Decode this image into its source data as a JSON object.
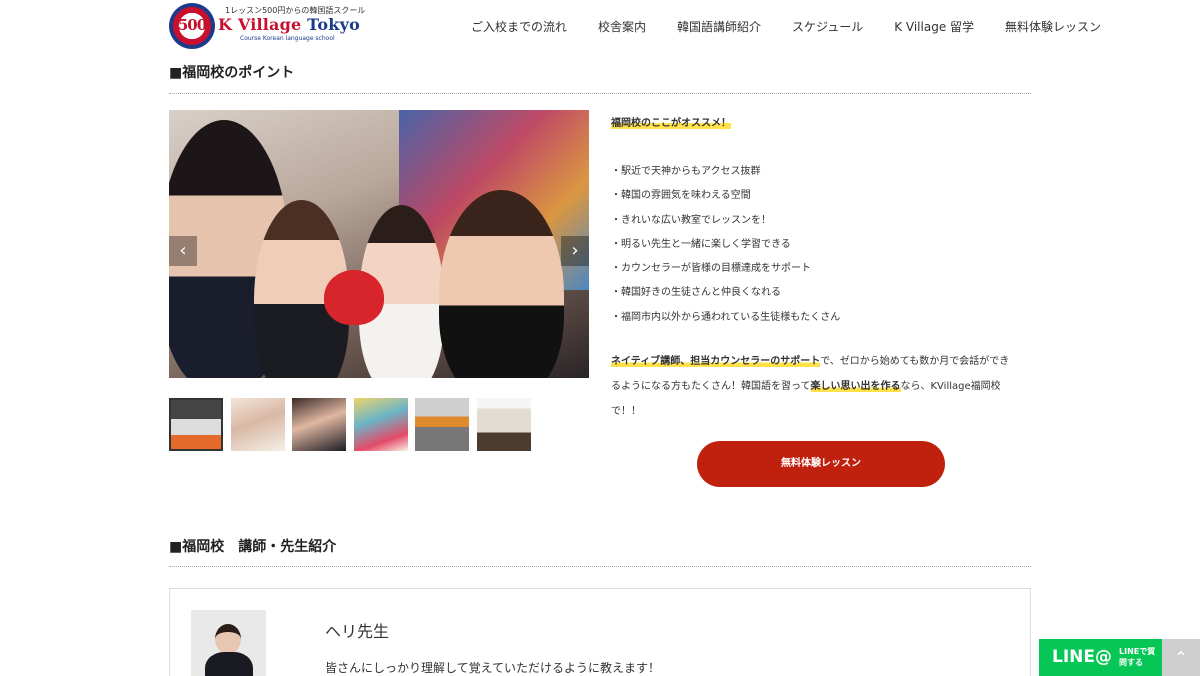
{
  "header": {
    "logo": {
      "badge_number": "500",
      "top_text": "1レッスン500円からの韓国語スクール",
      "main_text_a": "K Village ",
      "main_text_b": "Tokyo",
      "sub_text": "Course Korean language school"
    },
    "nav": [
      "ご入校までの流れ",
      "校舎案内",
      "韓国語講師紹介",
      "スケジュール",
      "K Village 留学",
      "無料体験レッスン"
    ]
  },
  "points_section": {
    "title": "■福岡校のポイント",
    "slider": {
      "prev_icon": "‹",
      "next_icon": "›"
    },
    "recommend_heading": "福岡校のここがオススメ！",
    "points": [
      "・駅近で天神からもアクセス抜群",
      "・韓国の雰囲気を味わえる空間",
      "・きれいな広い教室でレッスンを！",
      "・明るい先生と一緒に楽しく学習できる",
      "・カウンセラーが皆様の目標達成をサポート",
      "・韓国好きの生徒さんと仲良くなれる",
      "・福岡市内以外から通われている生徒様もたくさん"
    ],
    "paragraph": {
      "hl1": "ネイティブ講師、担当カウンセラーのサポート",
      "text1": "で、ゼロから始めても数か月で会話ができ",
      "text2": "るようになる方もたくさん！韓国語を習って",
      "hl2": "楽しい思い出を作る",
      "text3": "なら、KVillage福岡校",
      "text4": "で！！"
    },
    "cta_label": "無料体験レッスン"
  },
  "teachers_section": {
    "title": "■福岡校　講師・先生紹介",
    "teacher": {
      "name": "ヘリ先生",
      "description": "皆さんにしっかり理解して覚えていただけるように教えます！"
    }
  },
  "floating": {
    "line_logo": "LINE@",
    "line_sub": "LINEで質問する",
    "totop_icon": "⌃"
  },
  "colors": {
    "accent_red": "#c0210f",
    "highlight_yellow": "#ffe24a",
    "line_green": "#06c755"
  }
}
